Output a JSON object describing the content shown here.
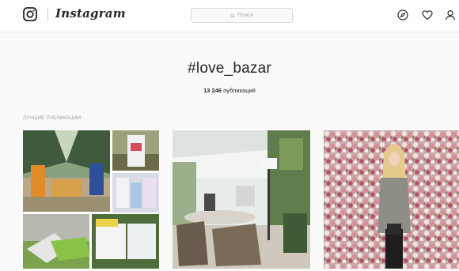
{
  "header": {
    "brand": "Instagram",
    "search_placeholder": "Поиск"
  },
  "icons": [
    "instagram-logo-icon",
    "search-icon",
    "compass-icon",
    "heart-icon",
    "profile-icon"
  ],
  "hashtag": {
    "title": "#love_bazar",
    "count": "13 246",
    "count_suffix": " публикаций"
  },
  "top_posts": {
    "label": "ЛУЧШИЕ ПУБЛИКАЦИИ"
  },
  "colors": {
    "background": "#fafafa",
    "header_bg": "#ffffff",
    "text": "#262626",
    "muted": "#999999"
  }
}
